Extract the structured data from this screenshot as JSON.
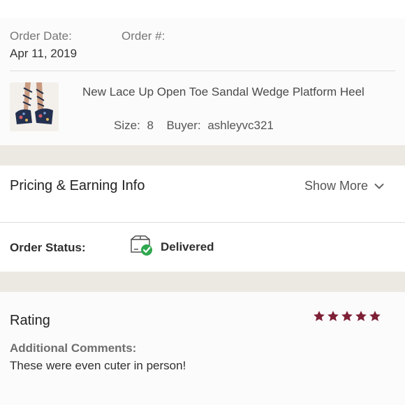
{
  "order": {
    "date_label": "Order Date:",
    "number_label": "Order #:",
    "date_value": "Apr 11, 2019"
  },
  "product": {
    "title": "New Lace Up Open Toe Sandal Wedge Platform Heel",
    "size_label": "Size:",
    "size_value": "8",
    "buyer_label": "Buyer:",
    "buyer_value": "ashleyvc321",
    "image_icon": "wedge-sandal-photo"
  },
  "pricing": {
    "title": "Pricing & Earning Info",
    "show_more_label": "Show More",
    "show_more_icon": "chevron-down-icon"
  },
  "status": {
    "label": "Order Status:",
    "value": "Delivered",
    "icon": "package-delivered-icon",
    "icon_color": "#2fa84f"
  },
  "rating": {
    "title": "Rating",
    "stars": 5,
    "max_stars": 5,
    "star_color": "#7d1f35",
    "comments_label": "Additional Comments:",
    "comments_text": "These were even cuter in person!"
  },
  "colors": {
    "band": "#ece8e2",
    "accent": "#7d1f35"
  }
}
